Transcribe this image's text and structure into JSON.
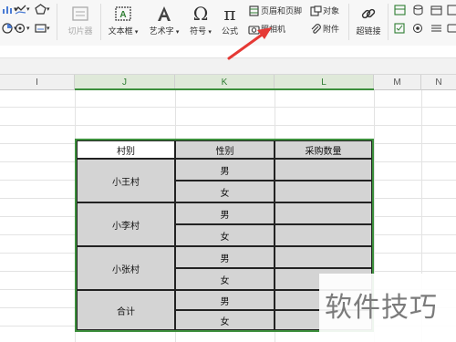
{
  "ribbon": {
    "gallery_button": "切片器",
    "textbox": "文本框",
    "wordart": "艺术字",
    "symbol": "符号",
    "formula": "公式",
    "header_footer": "页眉和页脚",
    "camera": "照相机",
    "object": "对象",
    "attachment": "附件",
    "hyperlink": "超链接"
  },
  "columns": [
    "I",
    "J",
    "K",
    "L",
    "M",
    "N"
  ],
  "table": {
    "headers": [
      "村别",
      "性别",
      "采购数量"
    ],
    "groups": [
      {
        "village": "小王村",
        "genders": [
          "男",
          "女"
        ]
      },
      {
        "village": "小李村",
        "genders": [
          "男",
          "女"
        ]
      },
      {
        "village": "小张村",
        "genders": [
          "男",
          "女"
        ]
      },
      {
        "village": "合计",
        "genders": [
          "男",
          "女"
        ]
      }
    ]
  },
  "watermark": "软件技巧",
  "colors": {
    "accent_green": "#3c8f3c",
    "arrow_red": "#e53935",
    "cell_gray": "#d4d4d4"
  }
}
